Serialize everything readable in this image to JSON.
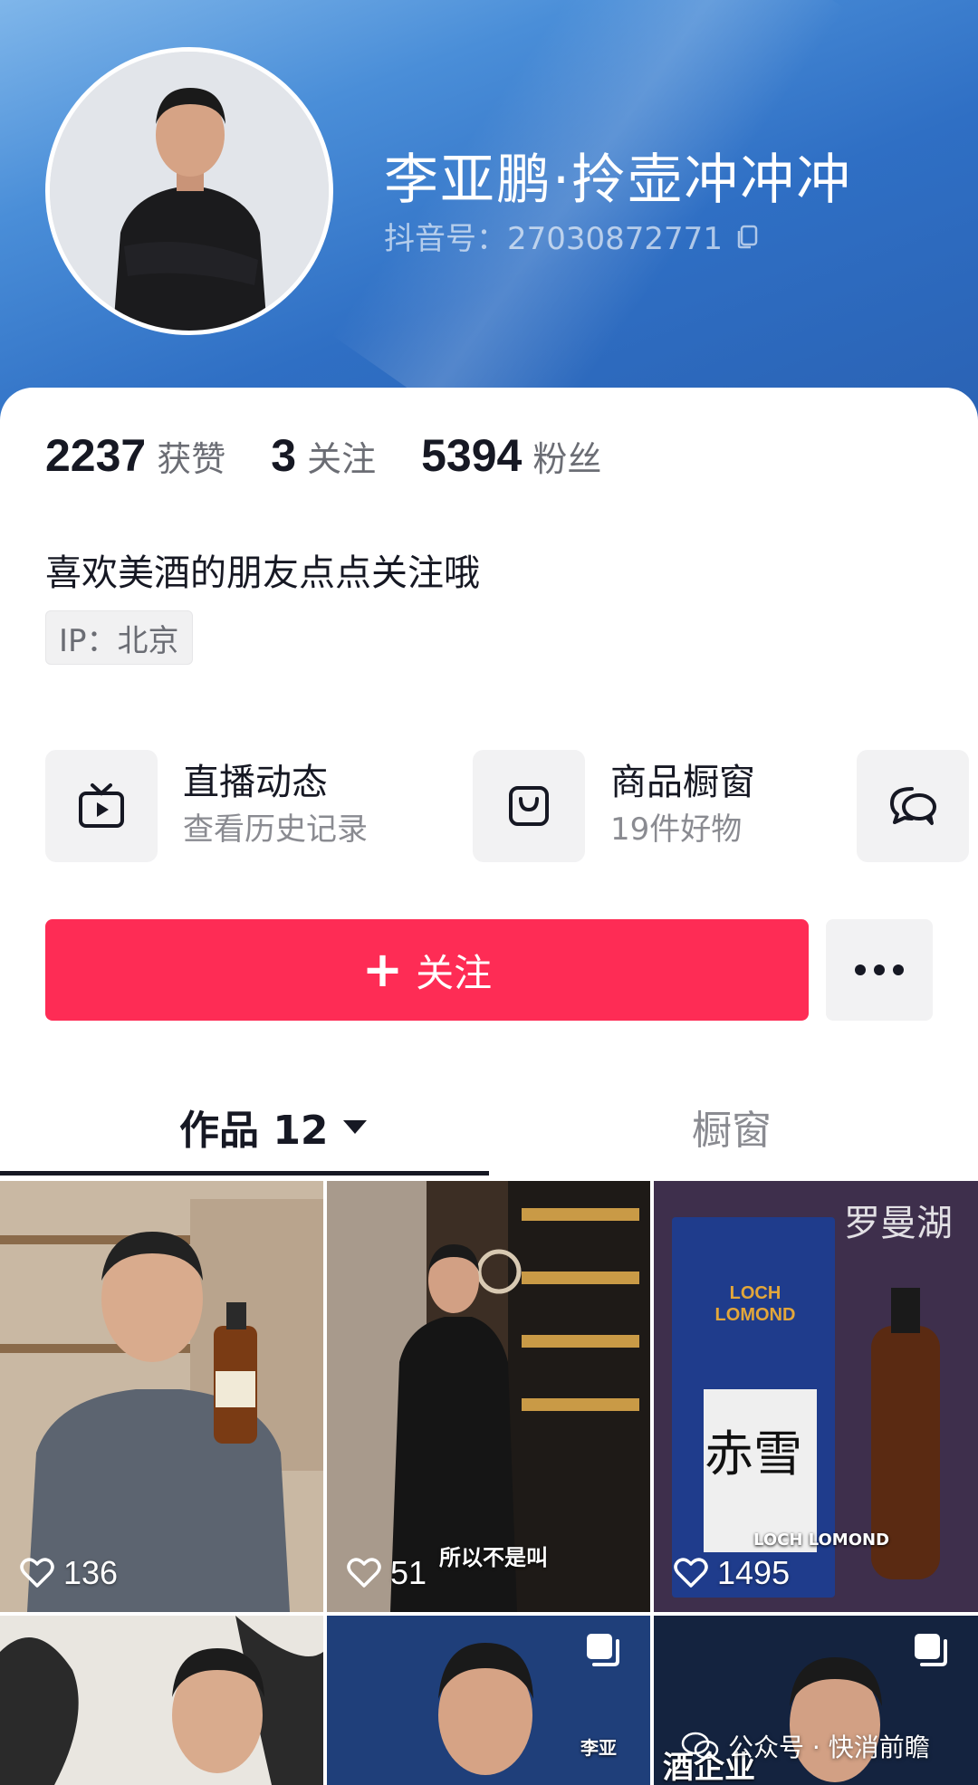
{
  "profile": {
    "nickname": "李亚鹏·拎壶冲冲冲",
    "douyin_id": "抖音号：27030872771"
  },
  "stats": [
    {
      "value": "2237",
      "label": "获赞"
    },
    {
      "value": "3",
      "label": "关注"
    },
    {
      "value": "5394",
      "label": "粉丝"
    }
  ],
  "bio": "喜欢美酒的朋友点点关注哦",
  "ip_location": "IP：北京",
  "features": {
    "live": {
      "title": "直播动态",
      "subtitle": "查看历史记录",
      "icon": "tv-play-icon"
    },
    "shop": {
      "title": "商品橱窗",
      "subtitle": "19件好物",
      "icon": "shopping-bag-icon"
    },
    "message_icon": "chat-bubbles-icon"
  },
  "follow_button": {
    "plus": "+",
    "label": "关注"
  },
  "more_icon": "more-dots-icon",
  "tabs": {
    "works": "作品 12",
    "shop": "橱窗"
  },
  "videos": [
    {
      "likes": "136"
    },
    {
      "likes": "51",
      "caption": "所以不是叫"
    },
    {
      "likes": "1495",
      "caption": "LOCH LOMOND"
    },
    {},
    {
      "caption": "李亚"
    },
    {
      "caption": "酒企业"
    }
  ],
  "watermark": "公众号 · 快消前瞻",
  "colors": {
    "accent": "#fe2c55",
    "header_blue": "#2f6fc4"
  }
}
